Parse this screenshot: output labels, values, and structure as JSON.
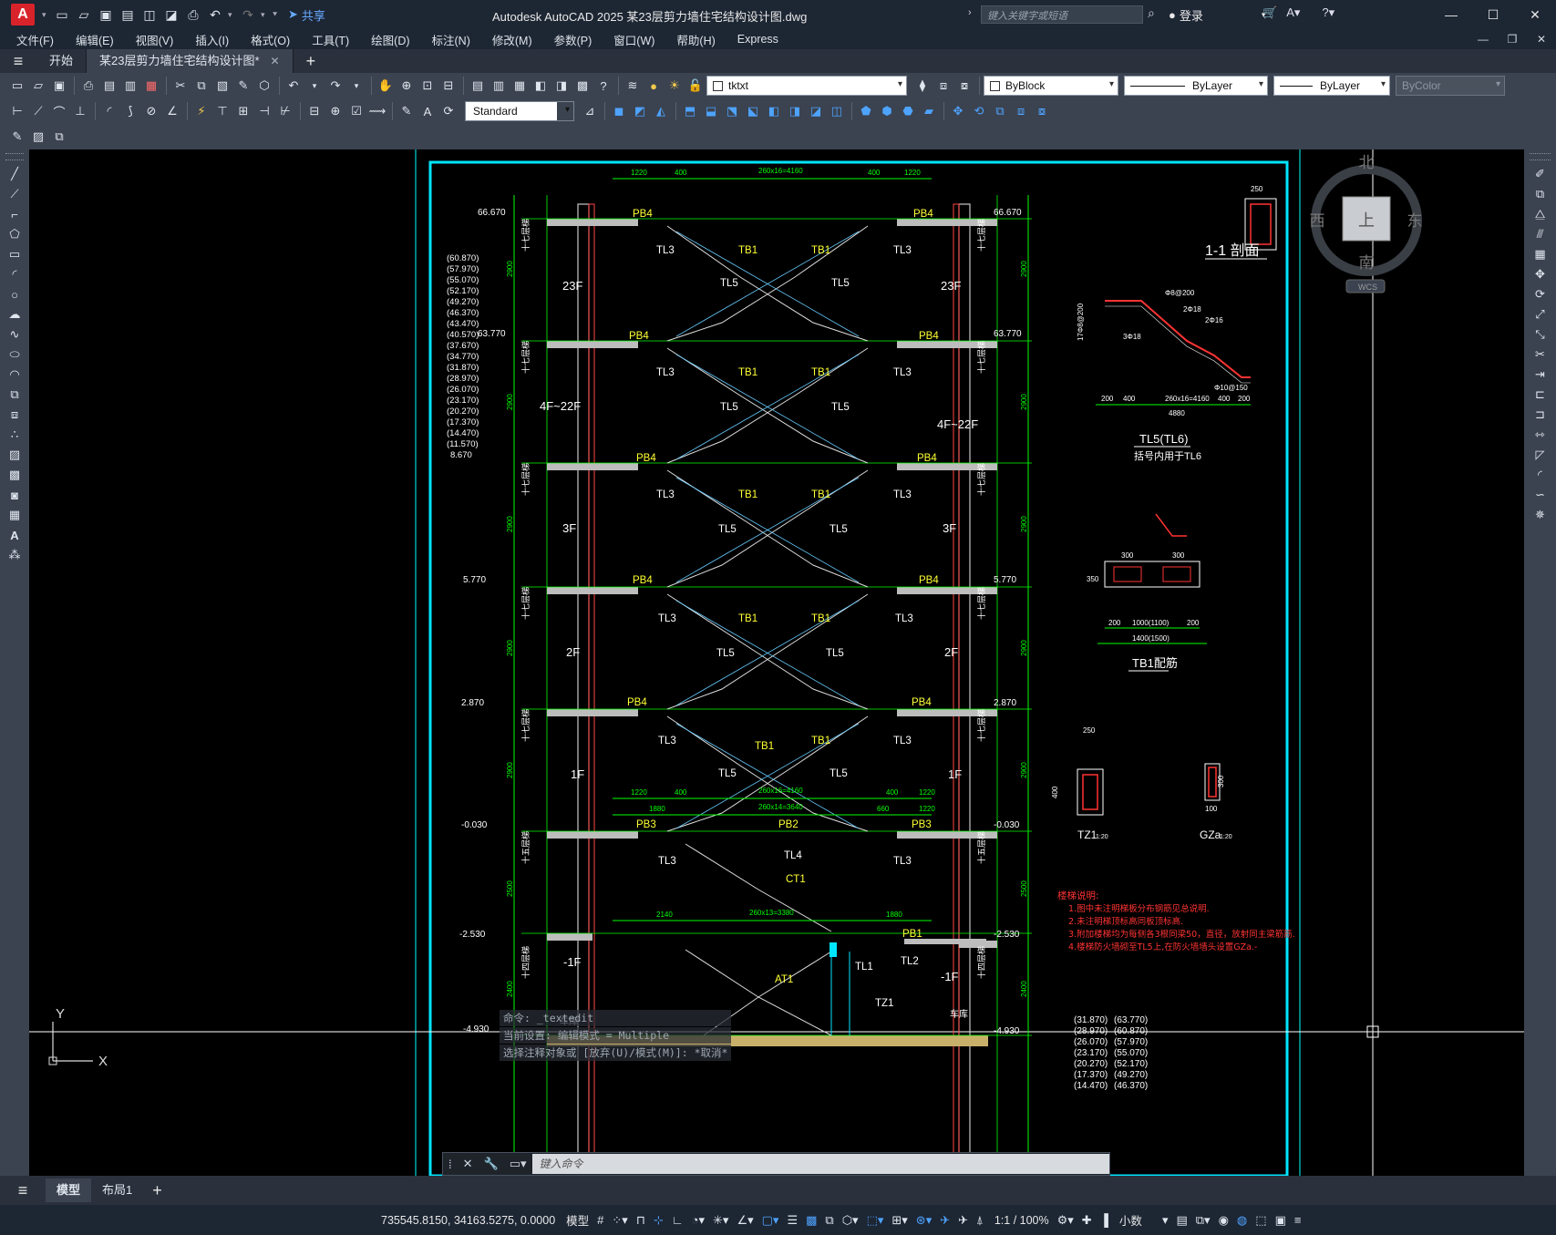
{
  "titlebar": {
    "logo": "A",
    "share_label": "共享",
    "window_title": "Autodesk AutoCAD 2025    某23层剪力墙住宅结构设计图.dwg",
    "search_placeholder": "键入关键字或短语",
    "login_label": "登录",
    "minimize": "—",
    "maximize": "☐",
    "close": "✕"
  },
  "menu": [
    "文件(F)",
    "编辑(E)",
    "视图(V)",
    "插入(I)",
    "格式(O)",
    "工具(T)",
    "绘图(D)",
    "标注(N)",
    "修改(M)",
    "参数(P)",
    "窗口(W)",
    "帮助(H)",
    "Express"
  ],
  "tabs": {
    "start_label": "开始",
    "doc_label": "某23层剪力墙住宅结构设计图*"
  },
  "toolbar": {
    "layer_name": "tktxt",
    "color_value": "ByBlock",
    "linetype_value": "ByLayer",
    "lineweight_value": "ByLayer",
    "plotstyle_value": "ByColor",
    "dimstyle_value": "Standard"
  },
  "viewcube": {
    "north": "北",
    "south": "南",
    "east": "东",
    "west": "西",
    "face": "上",
    "wcs": "WCS"
  },
  "ucs": {
    "x": "X",
    "y": "Y"
  },
  "drawing": {
    "top_dims": [
      "1220",
      "400",
      "260x16=4160",
      "400",
      "1220"
    ],
    "mid_dims1": [
      "1220",
      "400",
      "260x16=4160",
      "400",
      "1220"
    ],
    "mid_dims2": [
      "1880",
      "260x14=3640",
      "660",
      "1220"
    ],
    "bot_dims": [
      "2140",
      "260x13=3380",
      "1880"
    ],
    "elevations_left": [
      "66.670",
      "63.770",
      "5.770",
      "2.870",
      "-0.030",
      "-2.530",
      "-4.930"
    ],
    "elevations_right": [
      "66.670",
      "63.770",
      "5.770",
      "2.870",
      "-0.030",
      "-2.530",
      "-4.930"
    ],
    "elevation_list": [
      "(60.870)",
      "(57.970)",
      "(55.070)",
      "(52.170)",
      "(49.270)",
      "(46.370)",
      "(43.470)",
      "(40.570)",
      "(37.670)",
      "(34.770)",
      "(31.870)",
      "(28.970)",
      "(26.070)",
      "(23.170)",
      "(20.270)",
      "(17.370)",
      "(14.470)",
      "(11.570)",
      "8.670"
    ],
    "bottom_list_left": [
      "(31.870)",
      "(28.970)",
      "(26.070)",
      "(23.170)",
      "(20.270)",
      "(17.370)",
      "(14.470)"
    ],
    "bottom_list_right": [
      "(63.770)",
      "(60.870)",
      "(57.970)",
      "(55.070)",
      "(52.170)",
      "(49.270)",
      "(46.370)"
    ],
    "floors": [
      "23F",
      "4F~22F",
      "3F",
      "2F",
      "1F",
      "-1F"
    ],
    "story_label": "十七层梯",
    "story_label_b": "十五层梯",
    "story_label_c": "十四层梯",
    "heights": [
      "2900",
      "2500",
      "2400"
    ],
    "labels": {
      "pb4": "PB4",
      "pb3": "PB3",
      "pb2": "PB2",
      "pb1": "PB1",
      "tl3": "TL3",
      "tl5": "TL5",
      "tl4": "TL4",
      "tl1": "TL1",
      "tl2": "TL2",
      "tb1": "TB1",
      "ct1": "CT1",
      "at1": "AT1",
      "tz1": "TZ1",
      "garage": "车库"
    },
    "detail_section_title": "1-1 剖面",
    "detail_tl5_title": "TL5(TL6)",
    "detail_tl5_sub": "括号内用于TL6",
    "detail_tl5_dims": [
      "200",
      "400",
      "260x16=4160",
      "400",
      "200",
      "4880"
    ],
    "detail_rebar": [
      "Φ8@200",
      "2Φ18",
      "2Φ16",
      "3Φ18",
      "Φ10@150",
      "17Φ8@200"
    ],
    "detail_tb1_title": "TB1配筋",
    "detail_tb1_dims": [
      "200",
      "1000(1100)",
      "200",
      "1400(1500)",
      "300",
      "300",
      "350"
    ],
    "detail_tz1_title": "TZ1",
    "detail_gz_title": "GZa",
    "detail_scale": "1:20",
    "detail_dim_250": "250",
    "detail_dim_400": "400",
    "detail_dim_300": "300",
    "detail_dim_100": "100",
    "notes_title": "楼梯说明:",
    "notes": [
      "1.图中未注明梯板分布钢筋见总说明.",
      "2.未注明梯顶标高同板顶标高.",
      "3.附加楼梯均为每侧各3根同梁50，直径，放射同主梁筋筋.",
      "4.楼梯防火墙砌至TL5上,在防火墙墙头设置GZa.-"
    ]
  },
  "command": {
    "history": [
      "命令: _textedit",
      "当前设置: 编辑模式 = Multiple",
      "选择注释对象或 [放弃(U)/模式(M)]: *取消*"
    ],
    "placeholder": "键入命令"
  },
  "layout_tabs": {
    "model": "模型",
    "layout1": "布局1"
  },
  "status": {
    "coords": "735545.8150, 34163.5275, 0.0000",
    "model": "模型",
    "scale": "1:1 / 100%",
    "units": "小数"
  },
  "colors": {
    "canvas": "#000000",
    "frame": "#00e5ff",
    "wall": "#c8c8c8",
    "dim": "#00ff00",
    "label": "#ffff33",
    "note": "#ff3333",
    "stair": "#66ccff"
  }
}
